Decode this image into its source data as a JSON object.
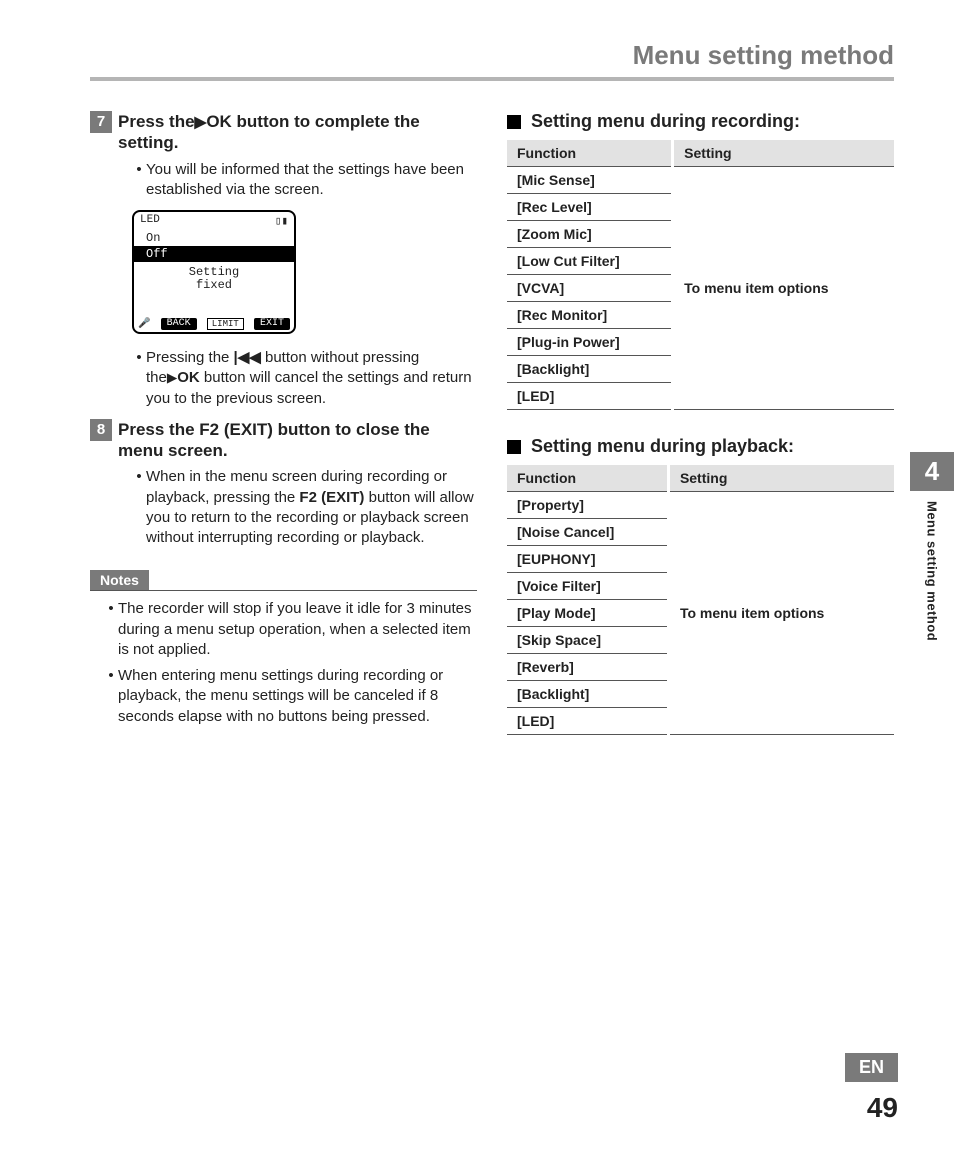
{
  "header": {
    "title": "Menu setting method"
  },
  "steps": [
    {
      "num": "7",
      "title_parts": [
        "Press the",
        "▶",
        "OK",
        " button to complete the setting."
      ],
      "bullets": [
        "You will be informed that the settings have been established via the screen."
      ],
      "screen": {
        "top_left": "LED",
        "opt1": "On",
        "opt2_selected": "Off",
        "msg1": "Setting",
        "msg2": "fixed",
        "bot_left": "BACK",
        "bot_mid": "LIMIT",
        "bot_right": "EXIT"
      },
      "bullets_after": [
        {
          "pre": "Pressing the ",
          "icon": "|◀◀",
          "mid": " button without pressing the",
          "icon2": "▶",
          "bold2": "OK",
          "post": " button will cancel the settings and return you to the previous screen."
        }
      ]
    },
    {
      "num": "8",
      "title_parts": [
        "Press the ",
        "F2 (EXIT)",
        " button to close the menu screen."
      ],
      "bullets": [
        {
          "pre": "When in the menu screen during recording or playback, pressing the ",
          "bold": "F2 (EXIT)",
          "post": " button will allow you to return to the recording or playback screen without interrupting recording or playback."
        }
      ]
    }
  ],
  "notes": {
    "label": "Notes",
    "items": [
      "The recorder will stop if you leave it idle for 3 minutes during a menu setup operation, when a selected item is not applied.",
      "When entering menu settings during recording or playback, the menu settings will be canceled if 8 seconds elapse with no buttons being pressed."
    ]
  },
  "tables": [
    {
      "title": "Setting menu during recording:",
      "headers": [
        "Function",
        "Setting"
      ],
      "rows": [
        "[Mic Sense]",
        "[Rec Level]",
        "[Zoom Mic]",
        "[Low Cut Filter]",
        "[VCVA]",
        "[Rec Monitor]",
        "[Plug-in Power]",
        "[Backlight]",
        "[LED]"
      ],
      "setting": "To menu item options"
    },
    {
      "title": "Setting menu during playback:",
      "headers": [
        "Function",
        "Setting"
      ],
      "rows": [
        "[Property]",
        "[Noise Cancel]",
        "[EUPHONY]",
        "[Voice Filter]",
        "[Play Mode]",
        "[Skip Space]",
        "[Reverb]",
        "[Backlight]",
        "[LED]"
      ],
      "setting": "To menu item options"
    }
  ],
  "sidebar": {
    "chapter": "4",
    "label": "Menu setting method"
  },
  "footer": {
    "lang": "EN",
    "page": "49"
  }
}
